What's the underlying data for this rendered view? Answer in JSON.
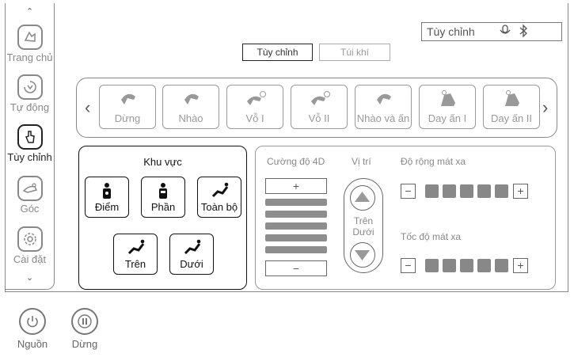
{
  "sidebar": {
    "items": [
      {
        "label": "Trang chủ",
        "icon": "hand-home-icon",
        "active": false
      },
      {
        "label": "Tự động",
        "icon": "auto-cycle-icon",
        "active": false
      },
      {
        "label": "Tùy chỉnh",
        "icon": "hand-touch-icon",
        "active": true
      },
      {
        "label": "Góc",
        "icon": "recline-angle-icon",
        "active": false
      },
      {
        "label": "Cài đặt",
        "icon": "gear-icon",
        "active": false
      }
    ]
  },
  "status": {
    "mode_text": "Tùy chỉnh",
    "icons": [
      "mic-icon",
      "bluetooth-icon"
    ]
  },
  "tabs": [
    {
      "label": "Tùy chỉnh",
      "active": true
    },
    {
      "label": "Túi khí",
      "active": false
    }
  ],
  "modes": [
    "Dừng",
    "Nhào",
    "Vỗ I",
    "Vỗ II",
    "Nhào và ấn",
    "Day ấn I",
    "Day ấn II"
  ],
  "region": {
    "title": "Khu vực",
    "row1": [
      "Điểm",
      "Phần",
      "Toàn bộ"
    ],
    "row2": [
      "Trên",
      "Dưới"
    ]
  },
  "intensity": {
    "label": "Cường độ 4D",
    "plus": "+",
    "minus": "−",
    "levels": 5
  },
  "position": {
    "label": "Vị trí",
    "up": "Trên",
    "down": "Dưới"
  },
  "width": {
    "label": "Độ rộng mát xa",
    "minus": "−",
    "plus": "+",
    "levels": 5
  },
  "speed": {
    "label": "Tốc độ mát xa",
    "minus": "−",
    "plus": "+",
    "levels": 5
  },
  "bottom": [
    {
      "label": "Nguồn",
      "icon": "power-icon"
    },
    {
      "label": "Dừng",
      "icon": "pause-icon"
    }
  ]
}
